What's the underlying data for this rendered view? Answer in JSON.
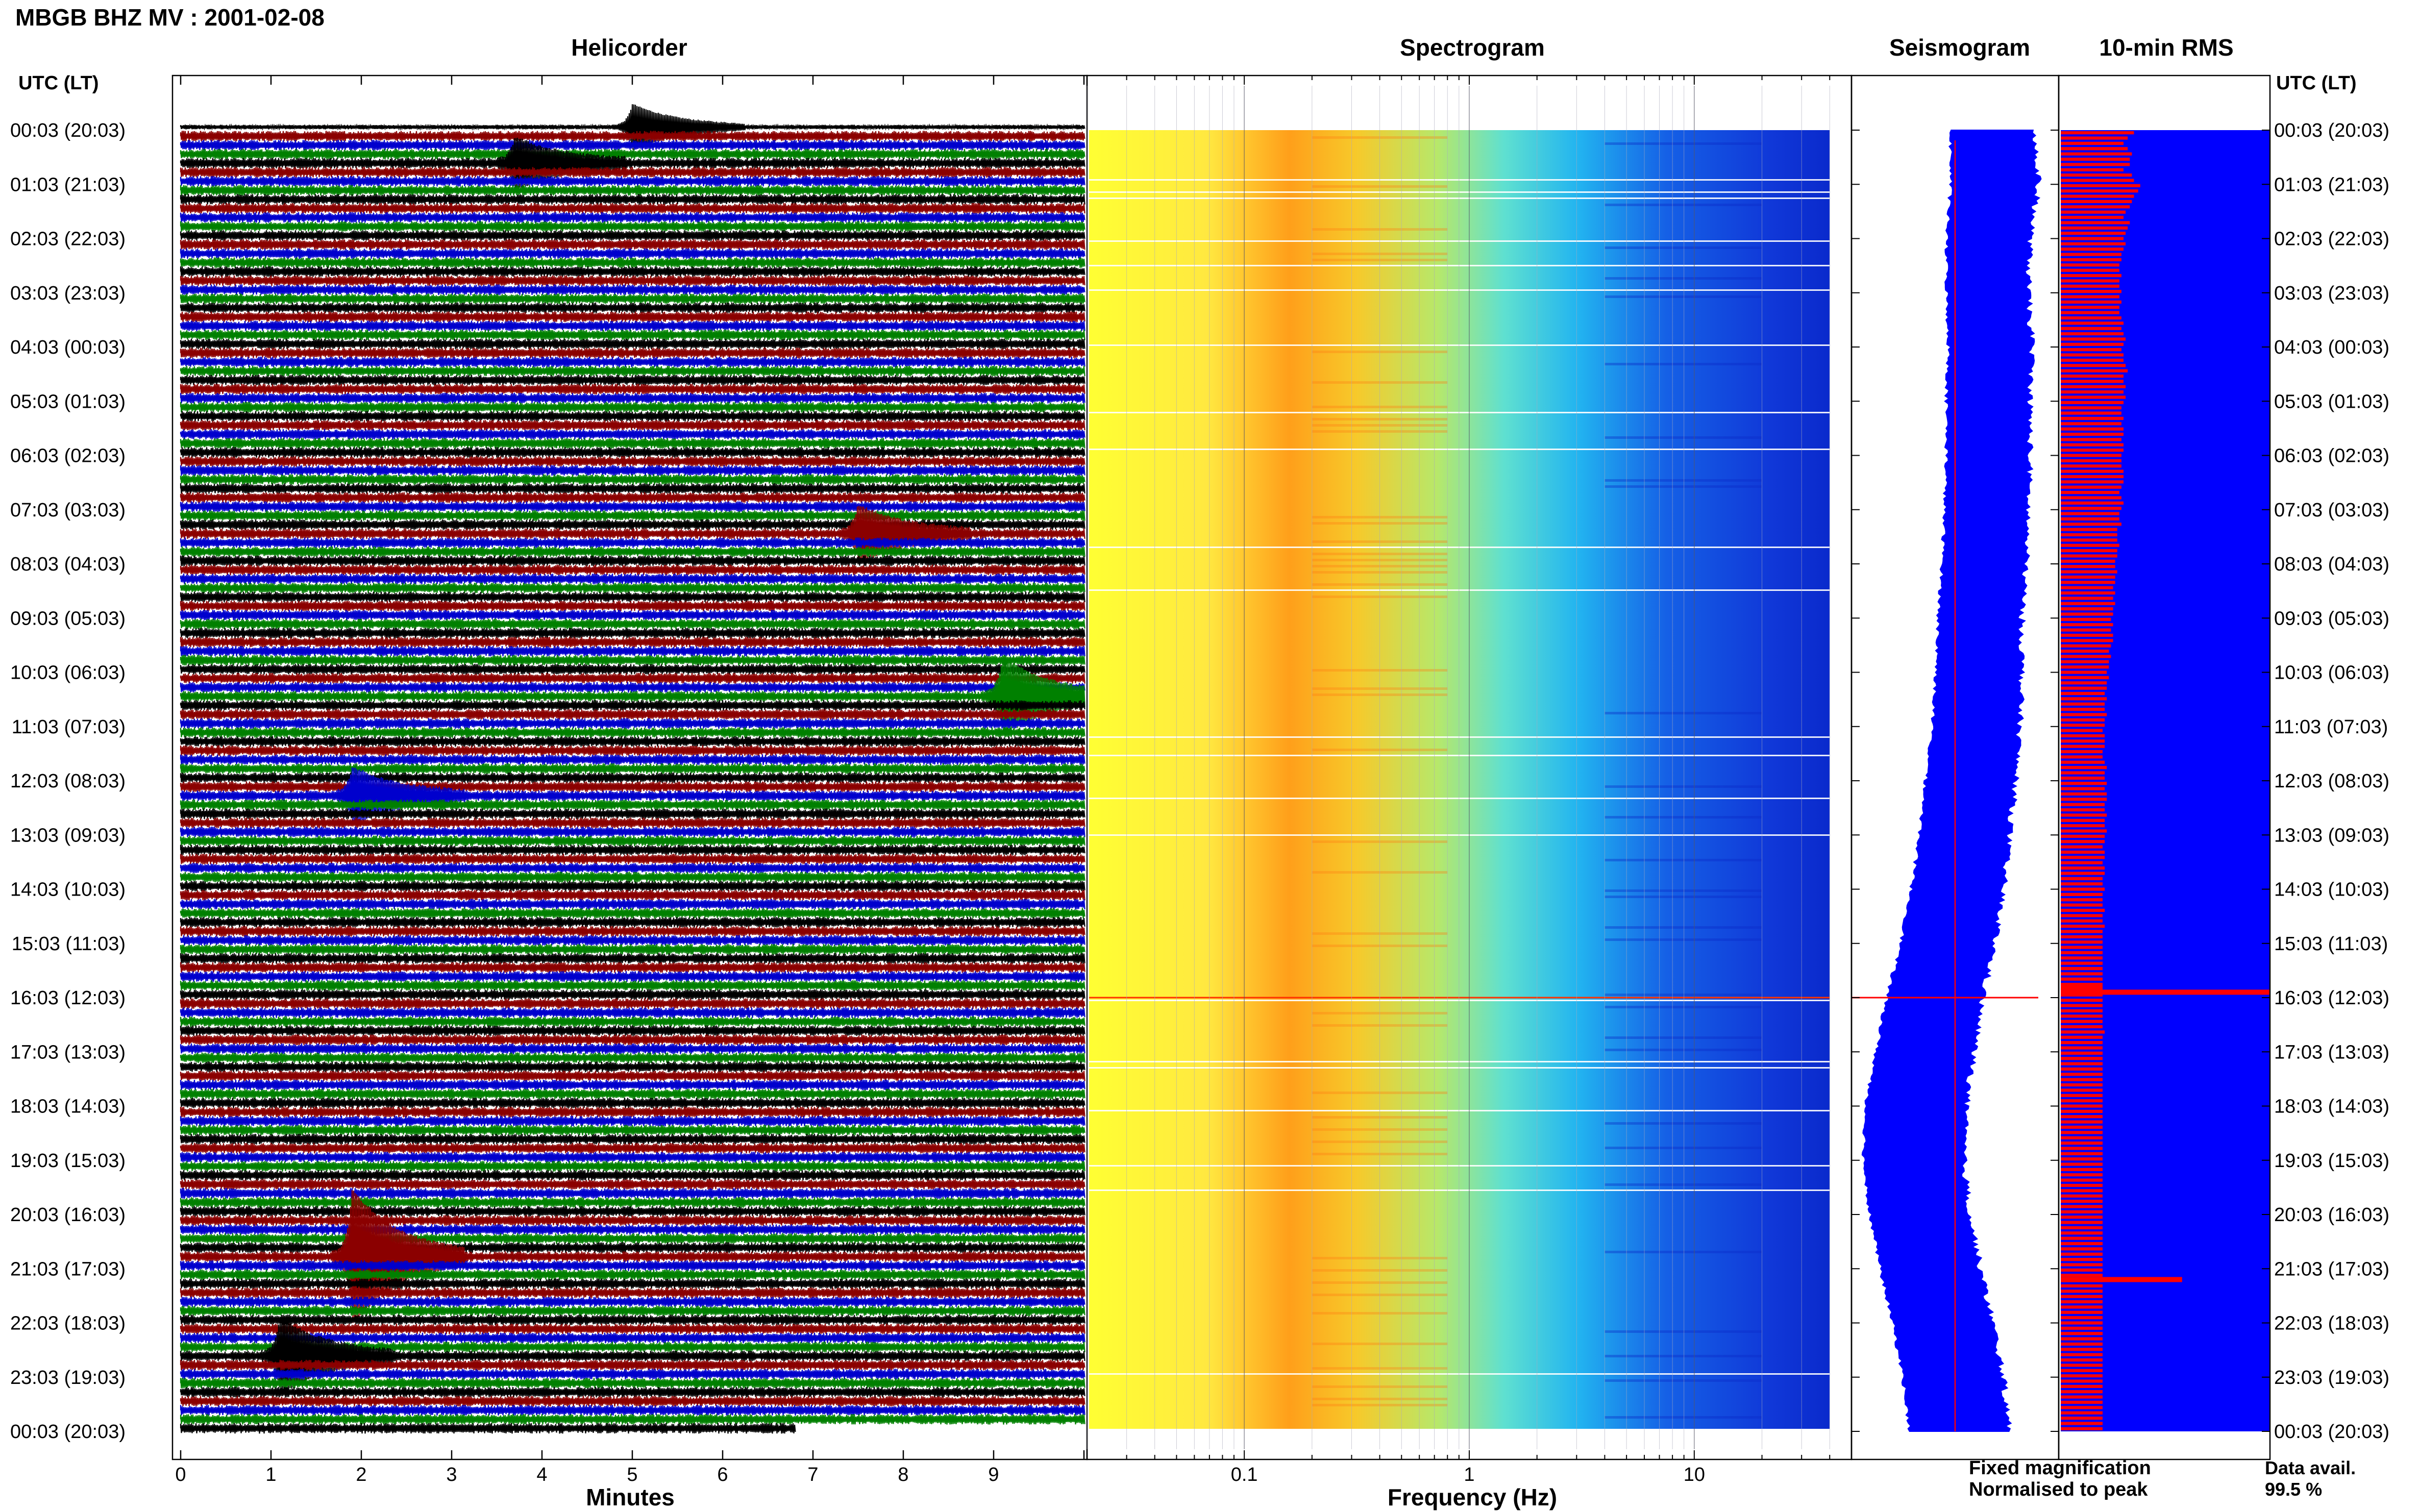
{
  "station_title": "MBGB BHZ MV : 2001-02-08",
  "panels": {
    "helicorder": "Helicorder",
    "spectrogram": "Spectrogram",
    "seismogram": "Seismogram",
    "rms": "10-min RMS"
  },
  "axis_titles": {
    "utc_left": "UTC (LT)",
    "utc_right": "UTC (LT)",
    "minutes": "Minutes",
    "frequency": "Frequency (Hz)"
  },
  "legend": {
    "fixed": "Fixed magnification",
    "normalised": "Normalised to peak",
    "fixed_color": "#0000ff",
    "normalised_color": "#ff0000"
  },
  "data_avail": {
    "label": "Data avail.",
    "value": "99.5 %"
  },
  "chart_data": [
    {
      "type": "line",
      "panel": "Helicorder",
      "xlabel": "Minutes",
      "x_ticks": [
        "0",
        "1",
        "2",
        "3",
        "4",
        "5",
        "6",
        "7",
        "8",
        "9"
      ],
      "xlim": [
        0,
        10
      ],
      "ylabel": "UTC (LT)",
      "row_labels": [
        "00:03 (20:03)",
        "01:03 (21:03)",
        "02:03 (22:03)",
        "03:03 (23:03)",
        "04:03 (00:03)",
        "05:03 (01:03)",
        "06:03 (02:03)",
        "07:03 (03:03)",
        "08:03 (04:03)",
        "09:03 (05:03)",
        "10:03 (06:03)",
        "11:03 (07:03)",
        "12:03 (08:03)",
        "13:03 (09:03)",
        "14:03 (10:03)",
        "15:03 (11:03)",
        "16:03 (12:03)",
        "17:03 (13:03)",
        "18:03 (14:03)",
        "19:03 (15:03)",
        "20:03 (16:03)",
        "21:03 (17:03)",
        "22:03 (18:03)",
        "23:03 (19:03)",
        "00:03 (20:03)"
      ],
      "trace_colors": [
        "#000000",
        "#8b0000",
        "#0000cd",
        "#008000"
      ],
      "traces_per_hour": 6,
      "last_trace_end_minutes": 6.8,
      "events": [
        {
          "hour_index": 0,
          "trace": 0,
          "minute": 5.0,
          "amplitude": 1.5
        },
        {
          "hour_index": 0,
          "trace": 4,
          "minute": 3.7,
          "amplitude": 1.6
        },
        {
          "hour_index": 7,
          "trace": 3,
          "minute": 7.5,
          "amplitude": 1.8
        },
        {
          "hour_index": 10,
          "trace": 3,
          "minute": 9.1,
          "amplitude": 2.5
        },
        {
          "hour_index": 12,
          "trace": 2,
          "minute": 1.9,
          "amplitude": 1.8
        },
        {
          "hour_index": 20,
          "trace": 5,
          "minute": 1.9,
          "amplitude": 4.5
        },
        {
          "hour_index": 22,
          "trace": 4,
          "minute": 1.1,
          "amplitude": 2.5
        }
      ]
    },
    {
      "type": "heatmap",
      "panel": "Spectrogram",
      "xlabel": "Frequency (Hz)",
      "x_scale": "log",
      "x_ticks": [
        "0.1",
        "1",
        "10"
      ],
      "xlim": [
        0.02,
        50
      ],
      "colormap": [
        "#ffff00",
        "#ff8c00",
        "#00ffff",
        "#0000ff"
      ],
      "dominant_band_hz": [
        0.18,
        0.35
      ],
      "data_end_hz": 40
    },
    {
      "type": "line",
      "panel": "Seismogram",
      "series": [
        {
          "name": "Fixed magnification",
          "color": "#0000ff",
          "hours": [
            0,
            1,
            2,
            3,
            4,
            5,
            6,
            7,
            8,
            9,
            10,
            11,
            12,
            13,
            14,
            15,
            16,
            17,
            18,
            19,
            20,
            21,
            22,
            23,
            24
          ],
          "left_offset": [
            0.48,
            0.48,
            0.46,
            0.46,
            0.47,
            0.46,
            0.46,
            0.45,
            0.44,
            0.42,
            0.41,
            0.39,
            0.36,
            0.33,
            0.29,
            0.24,
            0.17,
            0.12,
            0.07,
            0.06,
            0.09,
            0.14,
            0.2,
            0.25,
            0.28
          ],
          "width": [
            0.4,
            0.42,
            0.4,
            0.39,
            0.4,
            0.4,
            0.4,
            0.4,
            0.4,
            0.4,
            0.41,
            0.42,
            0.43,
            0.43,
            0.44,
            0.45,
            0.46,
            0.47,
            0.48,
            0.48,
            0.48,
            0.48,
            0.48,
            0.48,
            0.48
          ]
        },
        {
          "name": "Normalised to peak",
          "color": "#ff0000",
          "value": 0.5
        }
      ]
    },
    {
      "type": "bar",
      "panel": "10-min RMS",
      "orientation": "horizontal",
      "value_max": 1.0,
      "background_color": "#0000ff",
      "bar_color": "#ff0000",
      "values": [
        0.35,
        0.32,
        0.3,
        0.32,
        0.34,
        0.33,
        0.33,
        0.3,
        0.34,
        0.35,
        0.38,
        0.37,
        0.35,
        0.34,
        0.33,
        0.31,
        0.3,
        0.33,
        0.32,
        0.31,
        0.3,
        0.31,
        0.3,
        0.29,
        0.29,
        0.28,
        0.28,
        0.29,
        0.28,
        0.28,
        0.29,
        0.28,
        0.29,
        0.28,
        0.28,
        0.29,
        0.3,
        0.29,
        0.3,
        0.31,
        0.3,
        0.29,
        0.3,
        0.3,
        0.31,
        0.32,
        0.3,
        0.3,
        0.31,
        0.3,
        0.31,
        0.3,
        0.29,
        0.29,
        0.3,
        0.29,
        0.3,
        0.3,
        0.29,
        0.3,
        0.3,
        0.29,
        0.29,
        0.29,
        0.3,
        0.3,
        0.3,
        0.29,
        0.28,
        0.29,
        0.3,
        0.29,
        0.28,
        0.28,
        0.29,
        0.27,
        0.27,
        0.27,
        0.28,
        0.27,
        0.27,
        0.26,
        0.26,
        0.27,
        0.26,
        0.26,
        0.25,
        0.26,
        0.25,
        0.26,
        0.25,
        0.25,
        0.24,
        0.25,
        0.24,
        0.25,
        0.25,
        0.24,
        0.23,
        0.24,
        0.23,
        0.23,
        0.22,
        0.23,
        0.22,
        0.22,
        0.21,
        0.22,
        0.21,
        0.21,
        0.22,
        0.21,
        0.21,
        0.2,
        0.21,
        0.21,
        0.21,
        0.2,
        0.2,
        0.21,
        0.22,
        0.21,
        0.21,
        0.22,
        0.21,
        0.22,
        0.22,
        0.21,
        0.21,
        0.22,
        0.21,
        0.21,
        0.22,
        0.21,
        0.21,
        0.2,
        0.21,
        0.21,
        0.2,
        0.21,
        0.21,
        0.2,
        0.2,
        0.21,
        0.2,
        0.2,
        0.2,
        0.21,
        0.2,
        0.2,
        0.21,
        0.2,
        0.2,
        0.2,
        0.2,
        0.2,
        0.2,
        0.2,
        0.2,
        0.2,
        0.2,
        0.2,
        0.2,
        0.2,
        0.2,
        0.2,
        0.2,
        0.2,
        0.2,
        0.2,
        0.21,
        0.2,
        0.2,
        0.2,
        0.2,
        0.2,
        0.2,
        0.2,
        0.2,
        0.2,
        0.2,
        0.2,
        0.2,
        0.2,
        0.2,
        0.2,
        0.2,
        0.2,
        0.2,
        0.2,
        0.2,
        0.2,
        0.2,
        0.2,
        0.2,
        0.2,
        0.2,
        0.2,
        0.2,
        0.2,
        0.2,
        0.2,
        0.2,
        0.2,
        0.2,
        0.2,
        0.2,
        0.2,
        0.2,
        0.2,
        0.2,
        0.2,
        0.2,
        0.2,
        0.2,
        0.2,
        0.2,
        0.2,
        0.2,
        0.2,
        0.2,
        0.2,
        0.2,
        0.2,
        0.2,
        0.2,
        0.2,
        0.2,
        0.2,
        0.2,
        0.2,
        0.2,
        0.2,
        0.2,
        0.2,
        0.2,
        0.2,
        0.2,
        0.2,
        0.2,
        0.2,
        0.2,
        0.2,
        0.2,
        0.2,
        0.2
      ],
      "spikes": [
        {
          "hour": 15.9,
          "value": 1.0
        },
        {
          "hour": 15.8,
          "value": 0.2
        },
        {
          "hour": 21.2,
          "value": 0.58
        }
      ]
    }
  ]
}
